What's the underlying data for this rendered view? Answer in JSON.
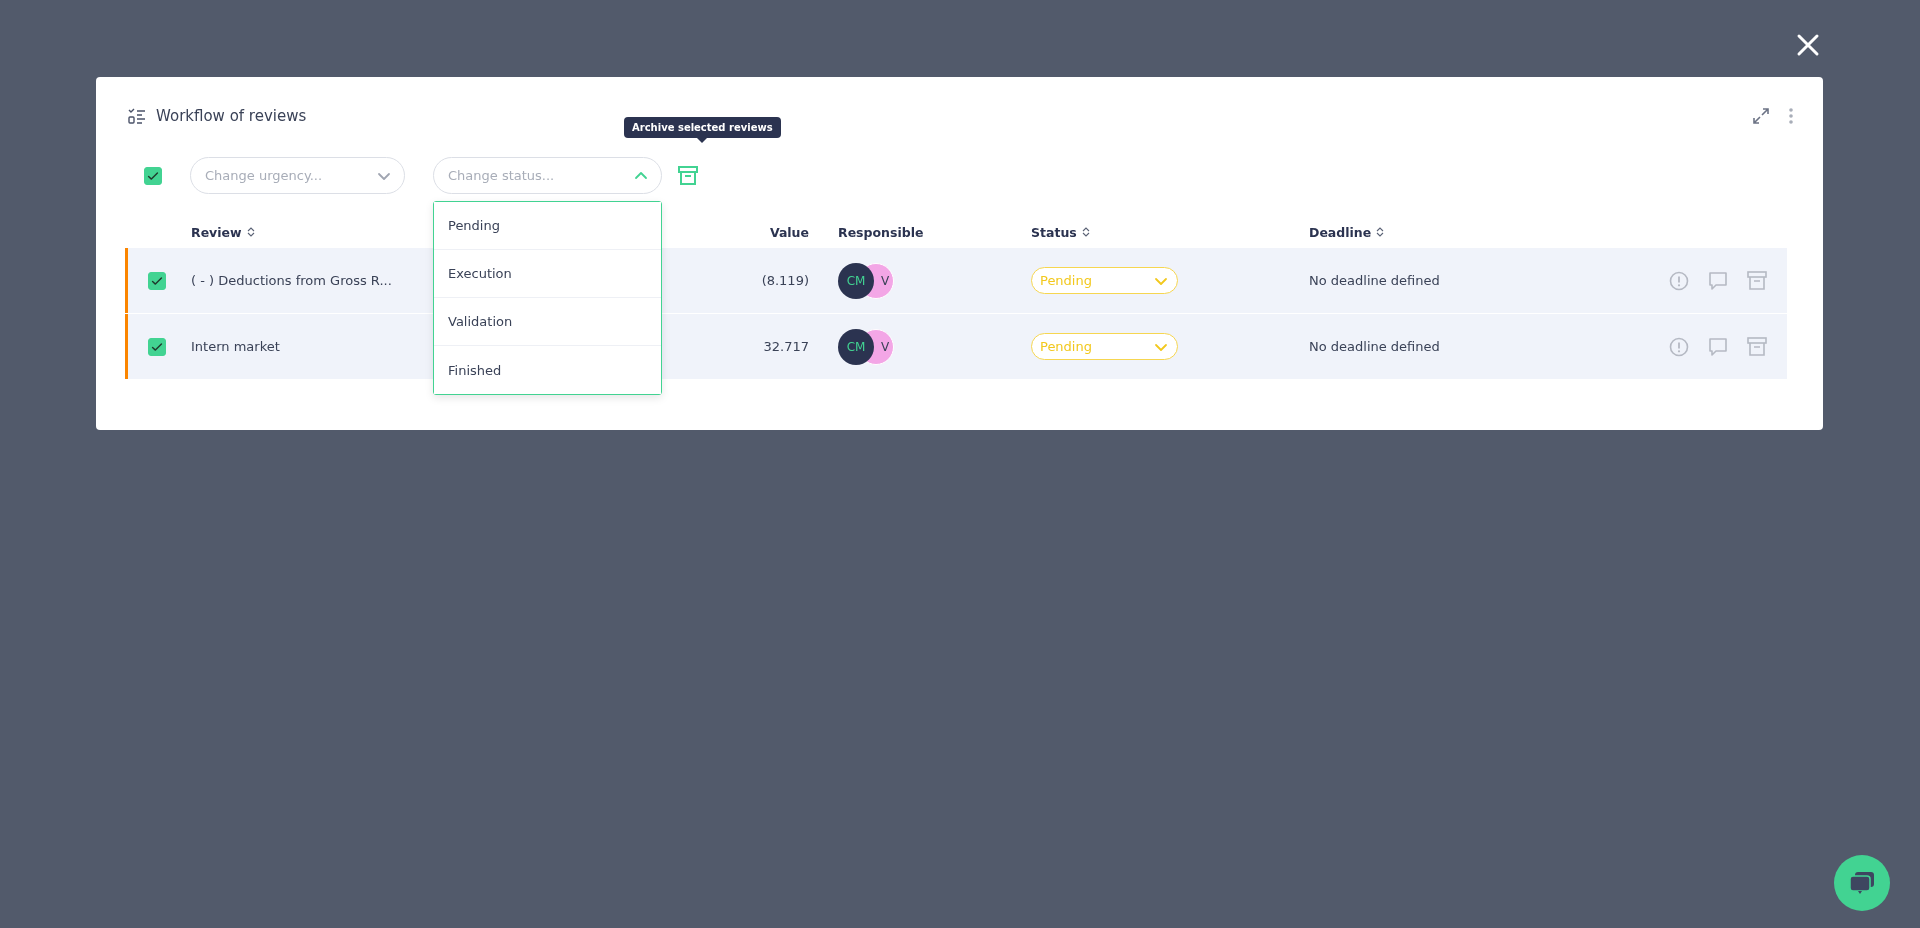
{
  "modal": {
    "title": "Workflow of reviews",
    "toolbar": {
      "select_all": {
        "checked": true
      },
      "urgency_select": {
        "placeholder": "Change urgency..."
      },
      "status_select": {
        "placeholder": "Change status...",
        "expanded": true,
        "options": [
          "Pending",
          "Execution",
          "Validation",
          "Finished"
        ]
      },
      "archive_tooltip": "Archive selected reviews"
    },
    "table": {
      "columns": [
        {
          "label": "Review",
          "sortable": true
        },
        {
          "label": "Value",
          "sortable": false
        },
        {
          "label": "Responsible",
          "sortable": false
        },
        {
          "label": "Status",
          "sortable": true
        },
        {
          "label": "Deadline",
          "sortable": true
        }
      ],
      "rows": [
        {
          "checked": true,
          "color": "#fb8500",
          "review": "( - ) Deductions from Gross R...",
          "value": "(8.119)",
          "responsible": [
            "CM",
            "V"
          ],
          "status": "Pending",
          "deadline": "No deadline defined"
        },
        {
          "checked": true,
          "color": "#fb8500",
          "review": "Intern market",
          "value": "32.717",
          "responsible": [
            "CM",
            "V"
          ],
          "status": "Pending",
          "deadline": "No deadline defined"
        }
      ]
    }
  }
}
